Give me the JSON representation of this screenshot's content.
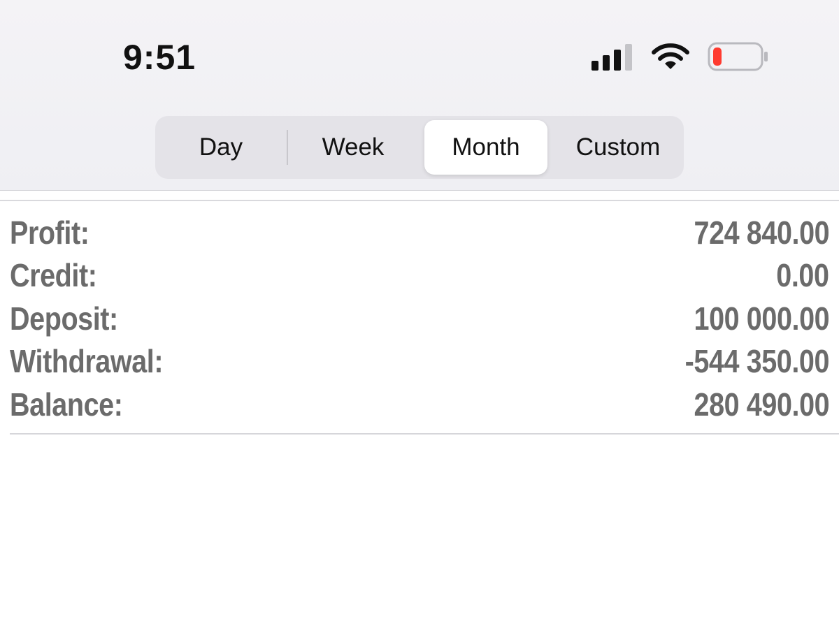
{
  "status_bar": {
    "time": "9:51",
    "icons": [
      "cellular-signal-icon",
      "wifi-icon",
      "battery-low-icon"
    ],
    "battery_color": "#ff3b30"
  },
  "period_selector": {
    "segments": [
      "Day",
      "Week",
      "Month",
      "Custom"
    ],
    "selected": "Month"
  },
  "summary": {
    "rows": [
      {
        "label": "Profit:",
        "value": "724 840.00"
      },
      {
        "label": "Credit:",
        "value": "0.00"
      },
      {
        "label": "Deposit:",
        "value": "100 000.00"
      },
      {
        "label": "Withdrawal:",
        "value": "-544 350.00"
      },
      {
        "label": "Balance:",
        "value": "280 490.00"
      }
    ],
    "text_color": "#6b6b6b"
  }
}
